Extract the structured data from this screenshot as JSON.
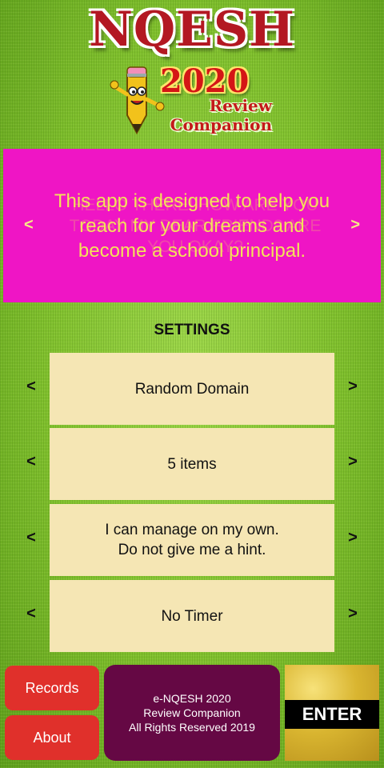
{
  "logo": {
    "title": "NQESH",
    "year": "2020",
    "subtitle_line1": "Review",
    "subtitle_line2": "Companion",
    "mascot_icon": "pencil-mascot-icon"
  },
  "banner": {
    "text": "This app is designed to help you reach for your dreams and become a school principal.",
    "ghost_text": "HELLO THERE! HOW ARE YOU TODAY MY DEAR FRIEND? ARE YOU OKAY?",
    "prev_label": "<",
    "next_label": ">",
    "bg_color": "#ef15c5",
    "text_color": "#f3e25a"
  },
  "settings": {
    "title": "SETTINGS",
    "items": [
      {
        "value": "Random Domain",
        "prev": "<",
        "next": ">"
      },
      {
        "value": "5 items",
        "prev": "<",
        "next": ">"
      },
      {
        "value_line1": "I can manage on my own.",
        "value_line2": "Do not give me a hint.",
        "prev": "<",
        "next": ">"
      },
      {
        "value": "No Timer",
        "prev": "<",
        "next": ">"
      }
    ]
  },
  "footer": {
    "records_label": "Records",
    "about_label": "About",
    "copyright_line1": "e-NQESH 2020",
    "copyright_line2": "Review Companion",
    "copyright_line3": "All Rights Reserved 2019",
    "enter_label": "ENTER"
  }
}
